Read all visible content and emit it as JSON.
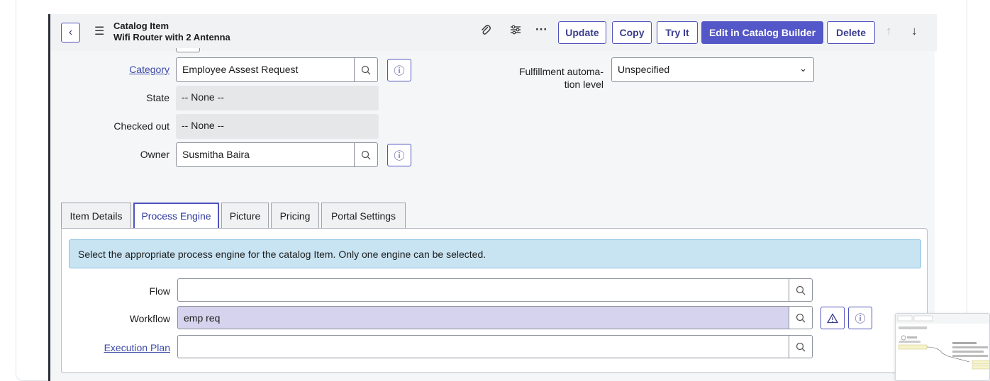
{
  "header": {
    "record_type": "Catalog Item",
    "record_name": "Wifi Router with 2 Antenna",
    "buttons": {
      "update": "Update",
      "copy": "Copy",
      "try_it": "Try It",
      "edit_catalog_builder": "Edit in Catalog Builder",
      "delete": "Delete"
    }
  },
  "fields": {
    "category": {
      "label": "Category",
      "value": "Employee Assest Request"
    },
    "state": {
      "label": "State",
      "value": "-- None --"
    },
    "checked_out": {
      "label": "Checked out",
      "value": "-- None --"
    },
    "owner": {
      "label": "Owner",
      "value": "Susmitha Baira"
    },
    "fulfillment": {
      "label_line1": "Fulfillment automa-",
      "label_line2": "tion level",
      "value": "Unspecified"
    }
  },
  "tabs": [
    {
      "label": "Item Details"
    },
    {
      "label": "Process Engine"
    },
    {
      "label": "Picture"
    },
    {
      "label": "Pricing"
    },
    {
      "label": "Portal Settings"
    }
  ],
  "active_tab": "Process Engine",
  "process_engine": {
    "banner": "Select the appropriate process engine for the catalog Item. Only one engine can be selected.",
    "flow": {
      "label": "Flow",
      "value": ""
    },
    "workflow": {
      "label": "Workflow",
      "value": "emp req"
    },
    "execution_plan": {
      "label": "Execution Plan",
      "value": ""
    }
  },
  "colors": {
    "accent": "#4f52bd",
    "primary_button": "#5457c7",
    "banner_bg": "#c8e3f2",
    "highlight_field": "#d6d3ee"
  }
}
